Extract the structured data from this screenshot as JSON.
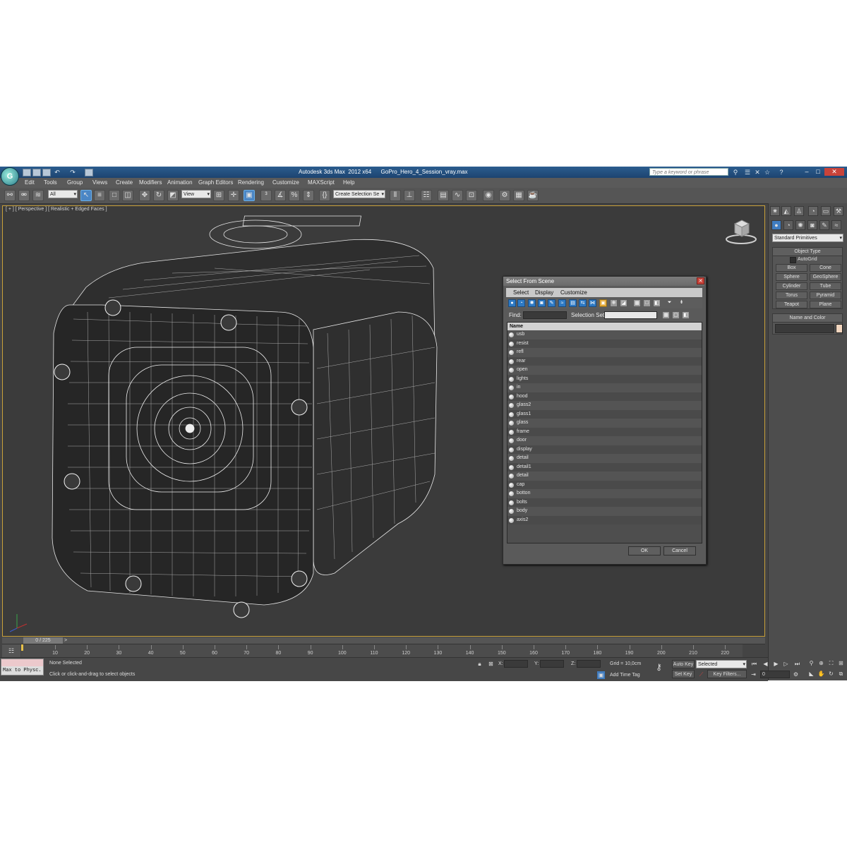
{
  "titlebar": {
    "app_title": "Autodesk 3ds Max  2012 x64",
    "file_name": "GoPro_Hero_4_Session_vray.max",
    "search_placeholder": "Type a keyword or phrase"
  },
  "menu": [
    "Edit",
    "Tools",
    "Group",
    "Views",
    "Create",
    "Modifiers",
    "Animation",
    "Graph Editors",
    "Rendering",
    "Customize",
    "MAXScript",
    "Help"
  ],
  "toolbar": {
    "selection_filter": "All",
    "reference_coord": "View",
    "named_selection": "Create Selection Se"
  },
  "viewport": {
    "label": "[ + ] [ Perspective ] [ Realistic + Edged Faces ]"
  },
  "command_panel": {
    "category": "Standard Primitives",
    "object_type_title": "Object Type",
    "autogrid": "AutoGrid",
    "primitives": [
      "Box",
      "Cone",
      "Sphere",
      "GeoSphere",
      "Cylinder",
      "Tube",
      "Torus",
      "Pyramid",
      "Teapot",
      "Plane"
    ],
    "name_color_title": "Name and Color"
  },
  "dialog": {
    "title": "Select From Scene",
    "menu": [
      "Select",
      "Display",
      "Customize"
    ],
    "find_label": "Find:",
    "selection_set_label": "Selection Set:",
    "column_header": "Name",
    "items": [
      "usb",
      "resist",
      "refl",
      "rear",
      "open",
      "lights",
      "in",
      "hood",
      "glass2",
      "glass1",
      "glass",
      "frame",
      "door",
      "display",
      "detail",
      "detail1",
      "detail",
      "cap",
      "botton",
      "bolts",
      "body",
      "axis2"
    ],
    "ok_label": "OK",
    "cancel_label": "Cancel"
  },
  "timeline": {
    "frame_display": "0 / 225",
    "ticks": [
      "10",
      "20",
      "30",
      "40",
      "50",
      "60",
      "70",
      "80",
      "90",
      "100",
      "110",
      "120",
      "130",
      "140",
      "150",
      "160",
      "170",
      "180",
      "190",
      "200",
      "210",
      "220"
    ]
  },
  "status": {
    "maxscript_listener": "Max to Physc.",
    "selection_status": "None Selected",
    "prompt": "Click or click-and-drag to select objects",
    "x_label": "X:",
    "y_label": "Y:",
    "z_label": "Z:",
    "grid": "Grid = 10,0cm",
    "add_time_tag": "Add Time Tag",
    "auto_key": "Auto Key",
    "set_key": "Set Key",
    "key_mode": "Selected",
    "key_filters": "Key Filters...",
    "current_frame": "0"
  }
}
